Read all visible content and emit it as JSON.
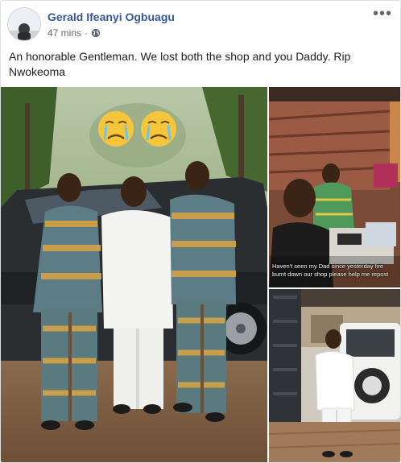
{
  "post": {
    "author": "Gerald Ifeanyi Ogbuagu",
    "timestamp": "47 mins",
    "separator": "·",
    "privacy_icon": "globe-icon",
    "more_label": "•••",
    "text": "An honorable Gentleman. We lost both the shop and you Daddy. Rip Nwokeoma"
  },
  "photos": {
    "main": {
      "emoji_icons": [
        "crying-face-icon",
        "crying-face-icon"
      ]
    },
    "top_right": {
      "caption": "Haven't seen my Dad since yesterday fire burnt down our shop please help me repost"
    },
    "bottom_right": {}
  },
  "colors": {
    "author_link": "#385898",
    "meta_text": "#606770",
    "border": "#dddfe2"
  }
}
